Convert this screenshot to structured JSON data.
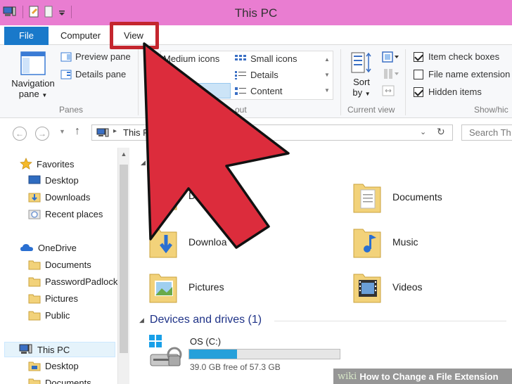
{
  "window": {
    "title": "This PC"
  },
  "ribbon_tabs": [
    {
      "label": "File"
    },
    {
      "label": "Computer"
    },
    {
      "label": "View"
    }
  ],
  "ribbon": {
    "panes": {
      "navigation_pane": "Navigation",
      "navigation_pane_line2": "pane",
      "preview_pane": "Preview pane",
      "details_pane": "Details pane",
      "group_label": "Panes"
    },
    "layout": {
      "medium_icons": "Medium icons",
      "small_icons": "Small icons",
      "details": "Details",
      "content": "Content",
      "group_label": "out"
    },
    "current_view": {
      "sort_by": "Sort",
      "sort_by_line2": "by",
      "group_label": "Current view"
    },
    "show_hide": {
      "item_check_boxes": {
        "label": "Item check boxes",
        "checked": true
      },
      "file_name_extensions": {
        "label": "File name extension",
        "checked": false
      },
      "hidden_items": {
        "label": "Hidden items",
        "checked": true
      },
      "group_label": "Show/hic"
    }
  },
  "address_bar": {
    "crumb": "This P",
    "search_placeholder": "Search Th"
  },
  "nav_pane": {
    "favorites": "Favorites",
    "desktop": "Desktop",
    "downloads": "Downloads",
    "recent_places": "Recent places",
    "onedrive": "OneDrive",
    "od_documents": "Documents",
    "od_passwordpadlock": "PasswordPadlock",
    "od_pictures": "Pictures",
    "od_public": "Public",
    "this_pc": "This PC",
    "pc_desktop": "Desktop",
    "pc_documents": "Documents"
  },
  "content": {
    "folders": {
      "desktop": "Des",
      "documents": "Documents",
      "downloads": "Downloa",
      "music": "Music",
      "pictures": "Pictures",
      "videos": "Videos"
    },
    "devices_header": "Devices and drives (1)",
    "drive": {
      "name": "OS (C:)",
      "free_text": "39.0 GB free of 57.3 GB",
      "used_fraction": 0.32
    }
  },
  "watermark": {
    "prefix": "wiki",
    "text": "How to Change a File Extension"
  },
  "colors": {
    "title_bar": "#e97dd1",
    "file_tab": "#1979ca",
    "annotation_red": "#c4262e"
  }
}
